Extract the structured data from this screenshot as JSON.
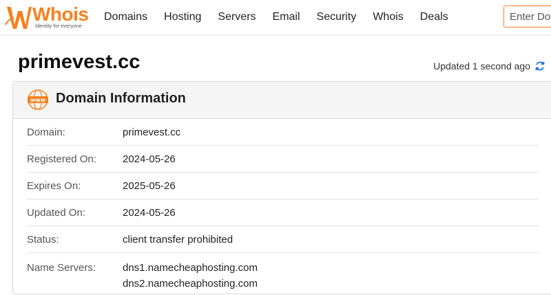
{
  "header": {
    "logo_text": "Whois",
    "logo_tagline": "Identity for everyone",
    "nav": [
      "Domains",
      "Hosting",
      "Servers",
      "Email",
      "Security",
      "Whois",
      "Deals"
    ],
    "search_placeholder": "Enter Domain"
  },
  "page": {
    "domain_title": "primevest.cc",
    "updated_text": "Updated 1 second ago"
  },
  "card": {
    "title": "Domain Information",
    "icon_text": "www",
    "rows": [
      {
        "label": "Domain:",
        "value": "primevest.cc"
      },
      {
        "label": "Registered On:",
        "value": "2024-05-26"
      },
      {
        "label": "Expires On:",
        "value": "2025-05-26"
      },
      {
        "label": "Updated On:",
        "value": "2024-05-26"
      },
      {
        "label": "Status:",
        "value": "client transfer prohibited"
      }
    ],
    "name_servers_label": "Name Servers:",
    "name_servers": [
      "dns1.namecheaphosting.com",
      "dns2.namecheaphosting.com"
    ]
  },
  "colors": {
    "brand": "#f58220",
    "refresh": "#1a73e8"
  }
}
